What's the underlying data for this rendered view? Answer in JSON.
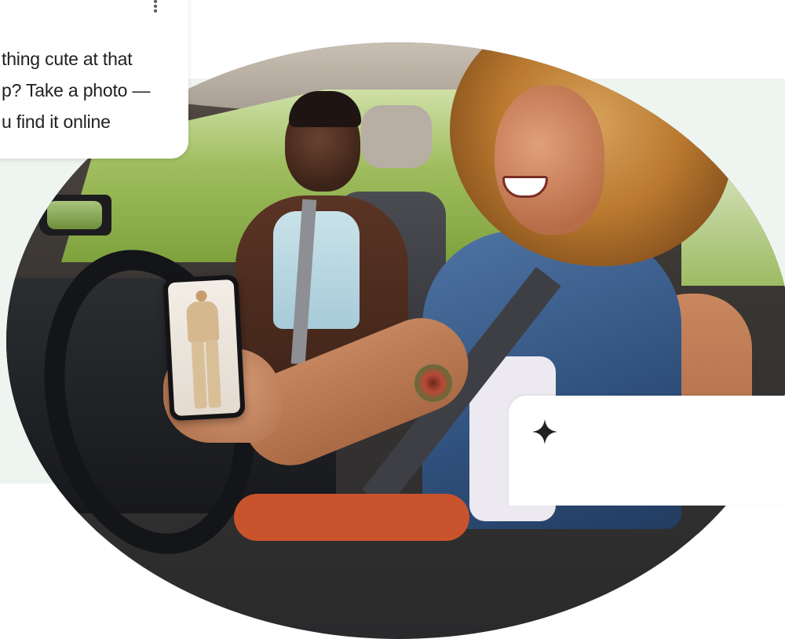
{
  "caption_card": {
    "text_lines": [
      "thing cute at that",
      "p? Take a photo —",
      "u find it online"
    ],
    "menu_icon": "more-vert-icon"
  },
  "bottom_card": {
    "icon": "sparkle-icon"
  },
  "photo": {
    "subject": "two women in a car, passenger holding a phone showing a beige outfit"
  },
  "colors": {
    "background_panel": "#eef5f0",
    "card": "#ffffff",
    "text": "#202124"
  }
}
